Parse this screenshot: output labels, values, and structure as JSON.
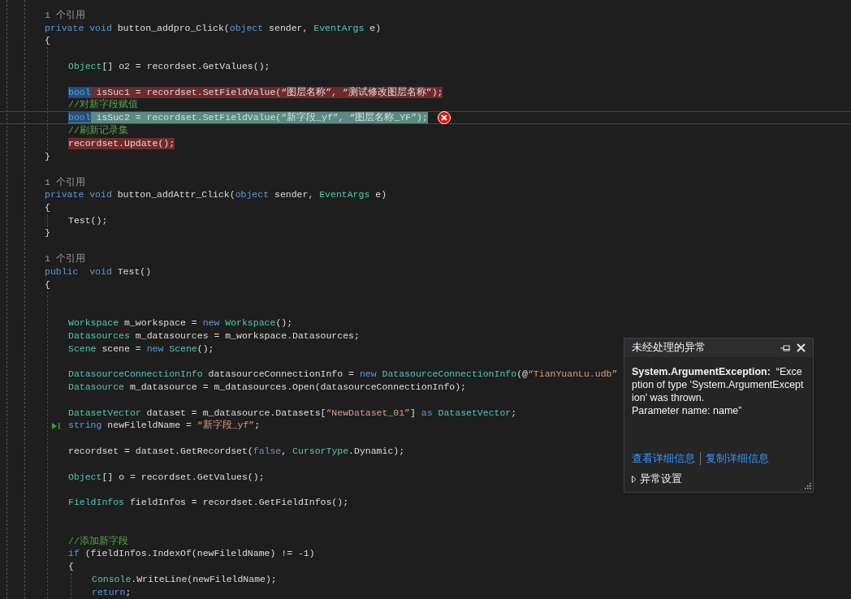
{
  "editor": {
    "lines": [
      {
        "kind": "reference",
        "text": "1 个引用"
      },
      {
        "kind": "code",
        "tokens": [
          {
            "kind": "kw",
            "text": "private void "
          },
          {
            "kind": "plain",
            "text": "button_addpro_Click("
          },
          {
            "kind": "kw",
            "text": "object"
          },
          {
            "kind": "plain",
            "text": " sender, "
          },
          {
            "kind": "type",
            "text": "EventArgs"
          },
          {
            "kind": "plain",
            "text": " e)"
          }
        ]
      },
      {
        "kind": "code",
        "tokens": [
          {
            "kind": "plain",
            "text": "{"
          }
        ],
        "children": [
          {
            "kind": "blank"
          },
          {
            "kind": "code",
            "tokens": [
              {
                "kind": "type",
                "text": "Object"
              },
              {
                "kind": "plain",
                "text": "[] o2 = recordset.GetValues();"
              }
            ]
          },
          {
            "kind": "blank"
          },
          {
            "kind": "code",
            "breakpoint": true,
            "tokens": [
              {
                "kind": "kw",
                "text": "bool",
                "selected": true
              },
              {
                "kind": "plain",
                "text": " isSuc1 = recordset.SetFieldValue("
              },
              {
                "kind": "plain",
                "text": "“图层名称”, “测试修改图层名称”);"
              }
            ]
          },
          {
            "kind": "code",
            "tokens": [
              {
                "kind": "comment",
                "text": "//对新字段赋值"
              }
            ]
          },
          {
            "kind": "code",
            "current": true,
            "caret": true,
            "error": true,
            "tokens": [
              {
                "kind": "kw",
                "text": "bool",
                "selected": true
              },
              {
                "kind": "plain",
                "text": " isSuc2 = recordset.SetFieldValue(“新字段_yf”, “图层名称_YF”);"
              }
            ]
          },
          {
            "kind": "code",
            "tokens": [
              {
                "kind": "comment",
                "text": "//刷新记录集"
              }
            ]
          },
          {
            "kind": "code",
            "breakpoint": true,
            "tokens": [
              {
                "kind": "plain",
                "text": "recordset.Update();"
              }
            ]
          }
        ]
      },
      {
        "kind": "code",
        "tokens": [
          {
            "kind": "plain",
            "text": "}"
          }
        ]
      },
      {
        "kind": "blank"
      },
      {
        "kind": "reference",
        "text": "1 个引用"
      },
      {
        "kind": "code",
        "tokens": [
          {
            "kind": "kw",
            "text": "private void "
          },
          {
            "kind": "plain",
            "text": "button_addAttr_Click("
          },
          {
            "kind": "kw",
            "text": "object"
          },
          {
            "kind": "plain",
            "text": " sender, "
          },
          {
            "kind": "type",
            "text": "EventArgs"
          },
          {
            "kind": "plain",
            "text": " e)"
          }
        ]
      },
      {
        "kind": "code",
        "tokens": [
          {
            "kind": "plain",
            "text": "{"
          }
        ],
        "children": [
          {
            "kind": "code",
            "tokens": [
              {
                "kind": "plain",
                "text": "Test();"
              }
            ]
          }
        ]
      },
      {
        "kind": "code",
        "tokens": [
          {
            "kind": "plain",
            "text": "}"
          }
        ]
      },
      {
        "kind": "blank"
      },
      {
        "kind": "reference",
        "text": "1 个引用"
      },
      {
        "kind": "code",
        "tokens": [
          {
            "kind": "kw",
            "text": "public  void "
          },
          {
            "kind": "plain",
            "text": "Test()"
          }
        ]
      },
      {
        "kind": "code",
        "tokens": [
          {
            "kind": "plain",
            "text": "{"
          }
        ],
        "children": [
          {
            "kind": "blank"
          },
          {
            "kind": "blank"
          },
          {
            "kind": "code",
            "tokens": [
              {
                "kind": "type",
                "text": "Workspace"
              },
              {
                "kind": "plain",
                "text": " m_workspace = "
              },
              {
                "kind": "kw",
                "text": "new "
              },
              {
                "kind": "type",
                "text": "Workspace"
              },
              {
                "kind": "plain",
                "text": "();"
              }
            ]
          },
          {
            "kind": "code",
            "tokens": [
              {
                "kind": "type",
                "text": "Datasources"
              },
              {
                "kind": "plain",
                "text": " m_datasources = m_workspace.Datasources;"
              }
            ]
          },
          {
            "kind": "code",
            "tokens": [
              {
                "kind": "type",
                "text": "Scene"
              },
              {
                "kind": "plain",
                "text": " scene = "
              },
              {
                "kind": "kw",
                "text": "new "
              },
              {
                "kind": "type",
                "text": "Scene"
              },
              {
                "kind": "plain",
                "text": "();"
              }
            ]
          },
          {
            "kind": "blank"
          },
          {
            "kind": "code",
            "tokens": [
              {
                "kind": "type",
                "text": "DatasourceConnectionInfo"
              },
              {
                "kind": "plain",
                "text": " datasourceConnectionInfo = "
              },
              {
                "kind": "kw",
                "text": "new "
              },
              {
                "kind": "type",
                "text": "DatasourceConnectionInfo"
              },
              {
                "kind": "plain",
                "text": "(@"
              },
              {
                "kind": "str",
                "text": "“TianYuanLu.udb”"
              }
            ]
          },
          {
            "kind": "code",
            "tokens": [
              {
                "kind": "type",
                "text": "Datasource"
              },
              {
                "kind": "plain",
                "text": " m_datasource = m_datasources.Open(datasourceConnectionInfo);"
              }
            ]
          },
          {
            "kind": "blank"
          },
          {
            "kind": "code",
            "tokens": [
              {
                "kind": "type",
                "text": "DatasetVector"
              },
              {
                "kind": "plain",
                "text": " dataset = m_datasource.Datasets["
              },
              {
                "kind": "str",
                "text": "“NewDataset_01”"
              },
              {
                "kind": "plain",
                "text": "] "
              },
              {
                "kind": "kw",
                "text": "as "
              },
              {
                "kind": "type",
                "text": "DatasetVector"
              },
              {
                "kind": "plain",
                "text": ";"
              }
            ]
          },
          {
            "kind": "code",
            "next_statement": true,
            "tokens": [
              {
                "kind": "kw",
                "text": "string"
              },
              {
                "kind": "plain",
                "text": " newFileldName = "
              },
              {
                "kind": "str",
                "text": "“新字段_yf”"
              },
              {
                "kind": "plain",
                "text": ";"
              }
            ]
          },
          {
            "kind": "blank"
          },
          {
            "kind": "code",
            "tokens": [
              {
                "kind": "plain",
                "text": "recordset = dataset.GetRecordset("
              },
              {
                "kind": "kw",
                "text": "false"
              },
              {
                "kind": "plain",
                "text": ", "
              },
              {
                "kind": "type",
                "text": "CursorType"
              },
              {
                "kind": "plain",
                "text": ".Dynamic);"
              }
            ]
          },
          {
            "kind": "blank"
          },
          {
            "kind": "code",
            "tokens": [
              {
                "kind": "type",
                "text": "Object"
              },
              {
                "kind": "plain",
                "text": "[] o = recordset.GetValues();"
              }
            ]
          },
          {
            "kind": "blank"
          },
          {
            "kind": "code",
            "tokens": [
              {
                "kind": "type",
                "text": "FieldInfos"
              },
              {
                "kind": "plain",
                "text": " fieldInfos = recordset.GetFieldInfos();"
              }
            ]
          },
          {
            "kind": "blank"
          },
          {
            "kind": "blank"
          },
          {
            "kind": "code",
            "tokens": [
              {
                "kind": "comment",
                "text": "//添加新字段"
              }
            ]
          },
          {
            "kind": "code",
            "tokens": [
              {
                "kind": "kw",
                "text": "if"
              },
              {
                "kind": "plain",
                "text": " (fieldInfos.IndexOf(newFileldName) != -1)"
              }
            ]
          },
          {
            "kind": "code",
            "tokens": [
              {
                "kind": "plain",
                "text": "{"
              }
            ],
            "children": [
              {
                "kind": "code",
                "tokens": [
                  {
                    "kind": "type",
                    "text": "Console"
                  },
                  {
                    "kind": "plain",
                    "text": ".WriteLine(newFileldName);"
                  }
                ]
              },
              {
                "kind": "code",
                "tokens": [
                  {
                    "kind": "kw",
                    "text": "return"
                  },
                  {
                    "kind": "plain",
                    "text": ";"
                  }
                ]
              }
            ]
          }
        ]
      }
    ]
  },
  "exception_popup": {
    "title": "未经处理的异常",
    "message": "**System.ArgumentException:**  “Exception of type 'System.ArgumentException' was thrown.\nParameter name: name”",
    "links": [
      "查看详细信息",
      "复制详细信息"
    ],
    "settings": {
      "label": "异常设置",
      "expanded": false
    }
  }
}
